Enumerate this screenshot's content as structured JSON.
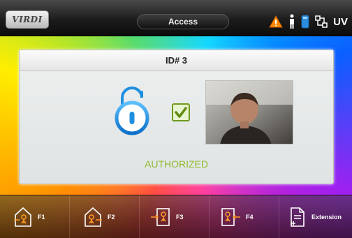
{
  "header": {
    "logo_text": "VIRDI",
    "title": "Access",
    "status_icons": [
      "warning-icon",
      "person-icon",
      "card-icon",
      "network-icon"
    ],
    "uv_label": "UV"
  },
  "panel": {
    "header": "ID# 3",
    "status": "AUTHORIZED",
    "lock_state": "unlocked",
    "check_state": "checked"
  },
  "function_keys": [
    {
      "label": "F1",
      "icon": "entry-house-icon"
    },
    {
      "label": "F2",
      "icon": "exit-house-icon"
    },
    {
      "label": "F3",
      "icon": "entry-door-icon"
    },
    {
      "label": "F4",
      "icon": "exit-door-icon"
    },
    {
      "label": "Extension",
      "icon": "extension-document-icon"
    }
  ],
  "colors": {
    "accent_blue": "#1e8fe0",
    "authorized_green": "#8fba2c",
    "warning_orange": "#ff8a00"
  }
}
